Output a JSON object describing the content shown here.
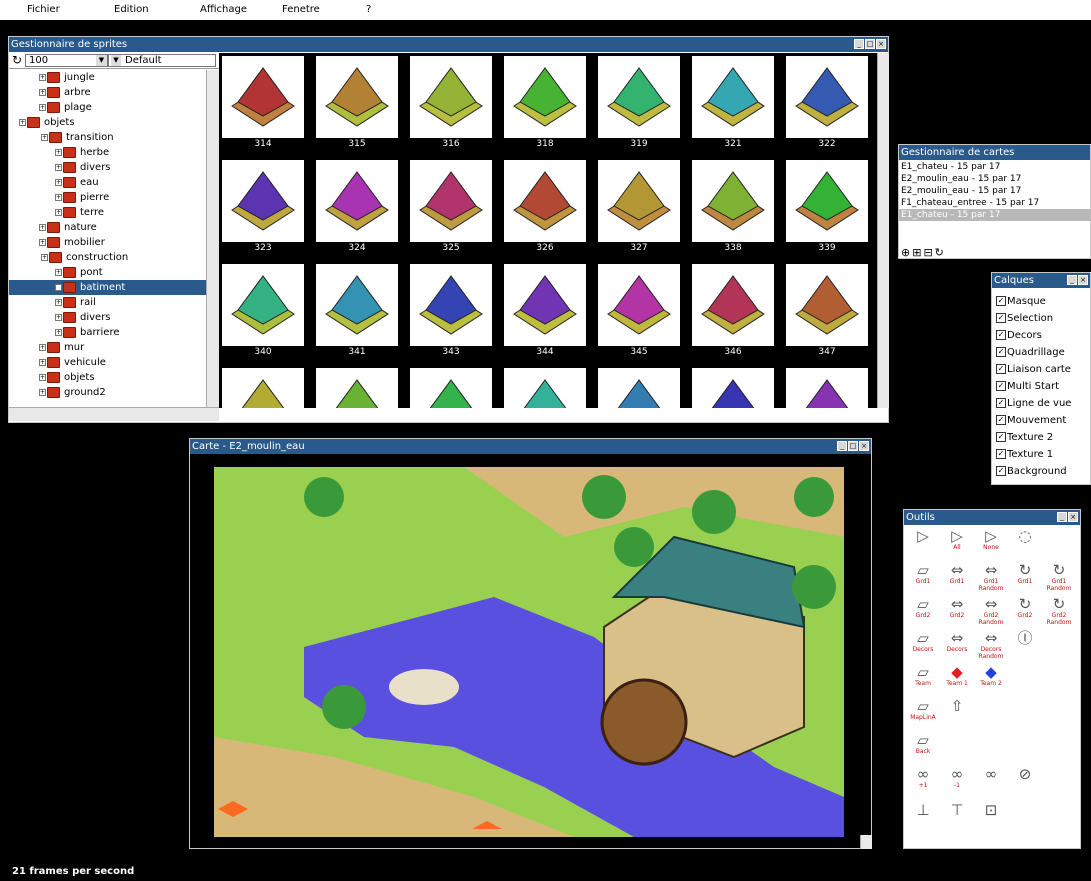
{
  "menu": [
    "Fichier",
    "Edition",
    "Affichage",
    "Fenetre",
    "?"
  ],
  "sprites_window": {
    "title": "Gestionnaire de sprites",
    "zoom": "100",
    "palette": "Default",
    "tree": [
      {
        "label": "jungle"
      },
      {
        "label": "arbre"
      },
      {
        "label": "plage"
      },
      {
        "label": "objets"
      },
      {
        "label": "transition"
      },
      {
        "label": "herbe"
      },
      {
        "label": "divers"
      },
      {
        "label": "eau"
      },
      {
        "label": "pierre"
      },
      {
        "label": "terre"
      },
      {
        "label": "nature"
      },
      {
        "label": "mobilier"
      },
      {
        "label": "construction"
      },
      {
        "label": "pont"
      },
      {
        "label": "batiment"
      },
      {
        "label": "rail"
      },
      {
        "label": "divers"
      },
      {
        "label": "barriere"
      },
      {
        "label": "mur"
      },
      {
        "label": "vehicule"
      },
      {
        "label": "objets"
      },
      {
        "label": "ground2"
      }
    ],
    "sprites": [
      "314",
      "315",
      "316",
      "318",
      "319",
      "321",
      "322",
      "323",
      "324",
      "325",
      "326",
      "327",
      "338",
      "339",
      "340",
      "341",
      "343",
      "344",
      "345",
      "346",
      "347"
    ]
  },
  "maps_window": {
    "title": "Gestionnaire de cartes",
    "maps": [
      "E1_chateu - 15 par 17",
      "E2_moulin_eau - 15 par 17",
      "E2_moulin_eau - 15 par 17",
      "F1_chateau_entree - 15 par 17",
      "E1_chateu - 15 par 17"
    ]
  },
  "layers_window": {
    "title": "Calques",
    "layers": [
      "Masque",
      "Selection",
      "Decors",
      "Quadrillage",
      "Liaison carte",
      "Multi Start",
      "Ligne de vue",
      "Mouvement",
      "Texture 2",
      "Texture 1",
      "Background"
    ]
  },
  "map_window": {
    "title": "Carte - E2_moulin_eau"
  },
  "tools_window": {
    "title": "Outils",
    "tools": [
      {
        "label": ""
      },
      {
        "label": "All"
      },
      {
        "label": "None"
      },
      {
        "label": ""
      },
      {
        "label": "Grd1"
      },
      {
        "label": "Grd1"
      },
      {
        "label": "Grd1 Random"
      },
      {
        "label": "Grd1"
      },
      {
        "label": "Grd1 Random"
      },
      {
        "label": "Grd2"
      },
      {
        "label": "Grd2"
      },
      {
        "label": "Grd2 Random"
      },
      {
        "label": "Grd2"
      },
      {
        "label": "Grd2 Random"
      },
      {
        "label": "Decors"
      },
      {
        "label": "Decors"
      },
      {
        "label": "Decors Random"
      },
      {
        "label": ""
      },
      {
        "label": "Team"
      },
      {
        "label": "Team 1"
      },
      {
        "label": "Team 2"
      },
      {
        "label": "MapLinA"
      },
      {
        "label": ""
      },
      {
        "label": "Back"
      },
      {
        "label": "+1"
      },
      {
        "label": "-1"
      },
      {
        "label": ""
      },
      {
        "label": ""
      },
      {
        "label": ""
      },
      {
        "label": ""
      },
      {
        "label": ""
      }
    ]
  },
  "status": "21 frames per second",
  "colors": {
    "title": "#2a5a8c",
    "selected": "#2a5a8c",
    "water": "#5a50e0",
    "grass": "#9ad050"
  }
}
